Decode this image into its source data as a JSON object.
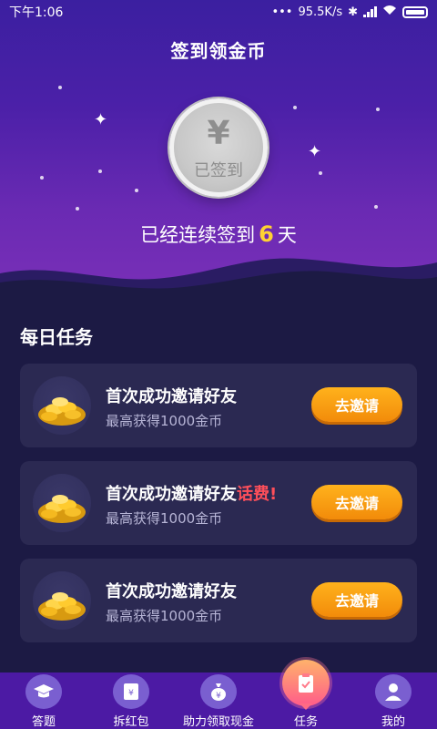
{
  "status_bar": {
    "time": "下午1:06",
    "speed": "95.5K/s"
  },
  "page": {
    "title": "签到领金币"
  },
  "checkin": {
    "coin_symbol": "¥",
    "coin_label": "已签到",
    "streak_prefix": "已经连续签到",
    "streak_days": "6",
    "streak_suffix": "天"
  },
  "tasks": {
    "section_title": "每日任务",
    "items": [
      {
        "title": "首次成功邀请好友",
        "highlight": "",
        "subtitle": "最高获得1000金币",
        "button": "去邀请"
      },
      {
        "title": "首次成功邀请好友",
        "highlight": "话费!",
        "subtitle": "最高获得1000金币",
        "button": "去邀请"
      },
      {
        "title": "首次成功邀请好友",
        "highlight": "",
        "subtitle": "最高获得1000金币",
        "button": "去邀请"
      }
    ]
  },
  "bottom_nav": {
    "items": [
      {
        "label": "答题",
        "icon": "graduation-cap-icon"
      },
      {
        "label": "拆红包",
        "icon": "red-envelope-icon"
      },
      {
        "label": "助力领取现金",
        "icon": "money-bag-icon"
      },
      {
        "label": "任务",
        "icon": "task-clipboard-icon",
        "active": true
      },
      {
        "label": "我的",
        "icon": "user-icon"
      }
    ]
  },
  "colors": {
    "accent_gold": "#ffd233",
    "button_orange": "#f9a010",
    "highlight_red": "#ff4f5a",
    "nav_bg": "#4c1aa4"
  }
}
